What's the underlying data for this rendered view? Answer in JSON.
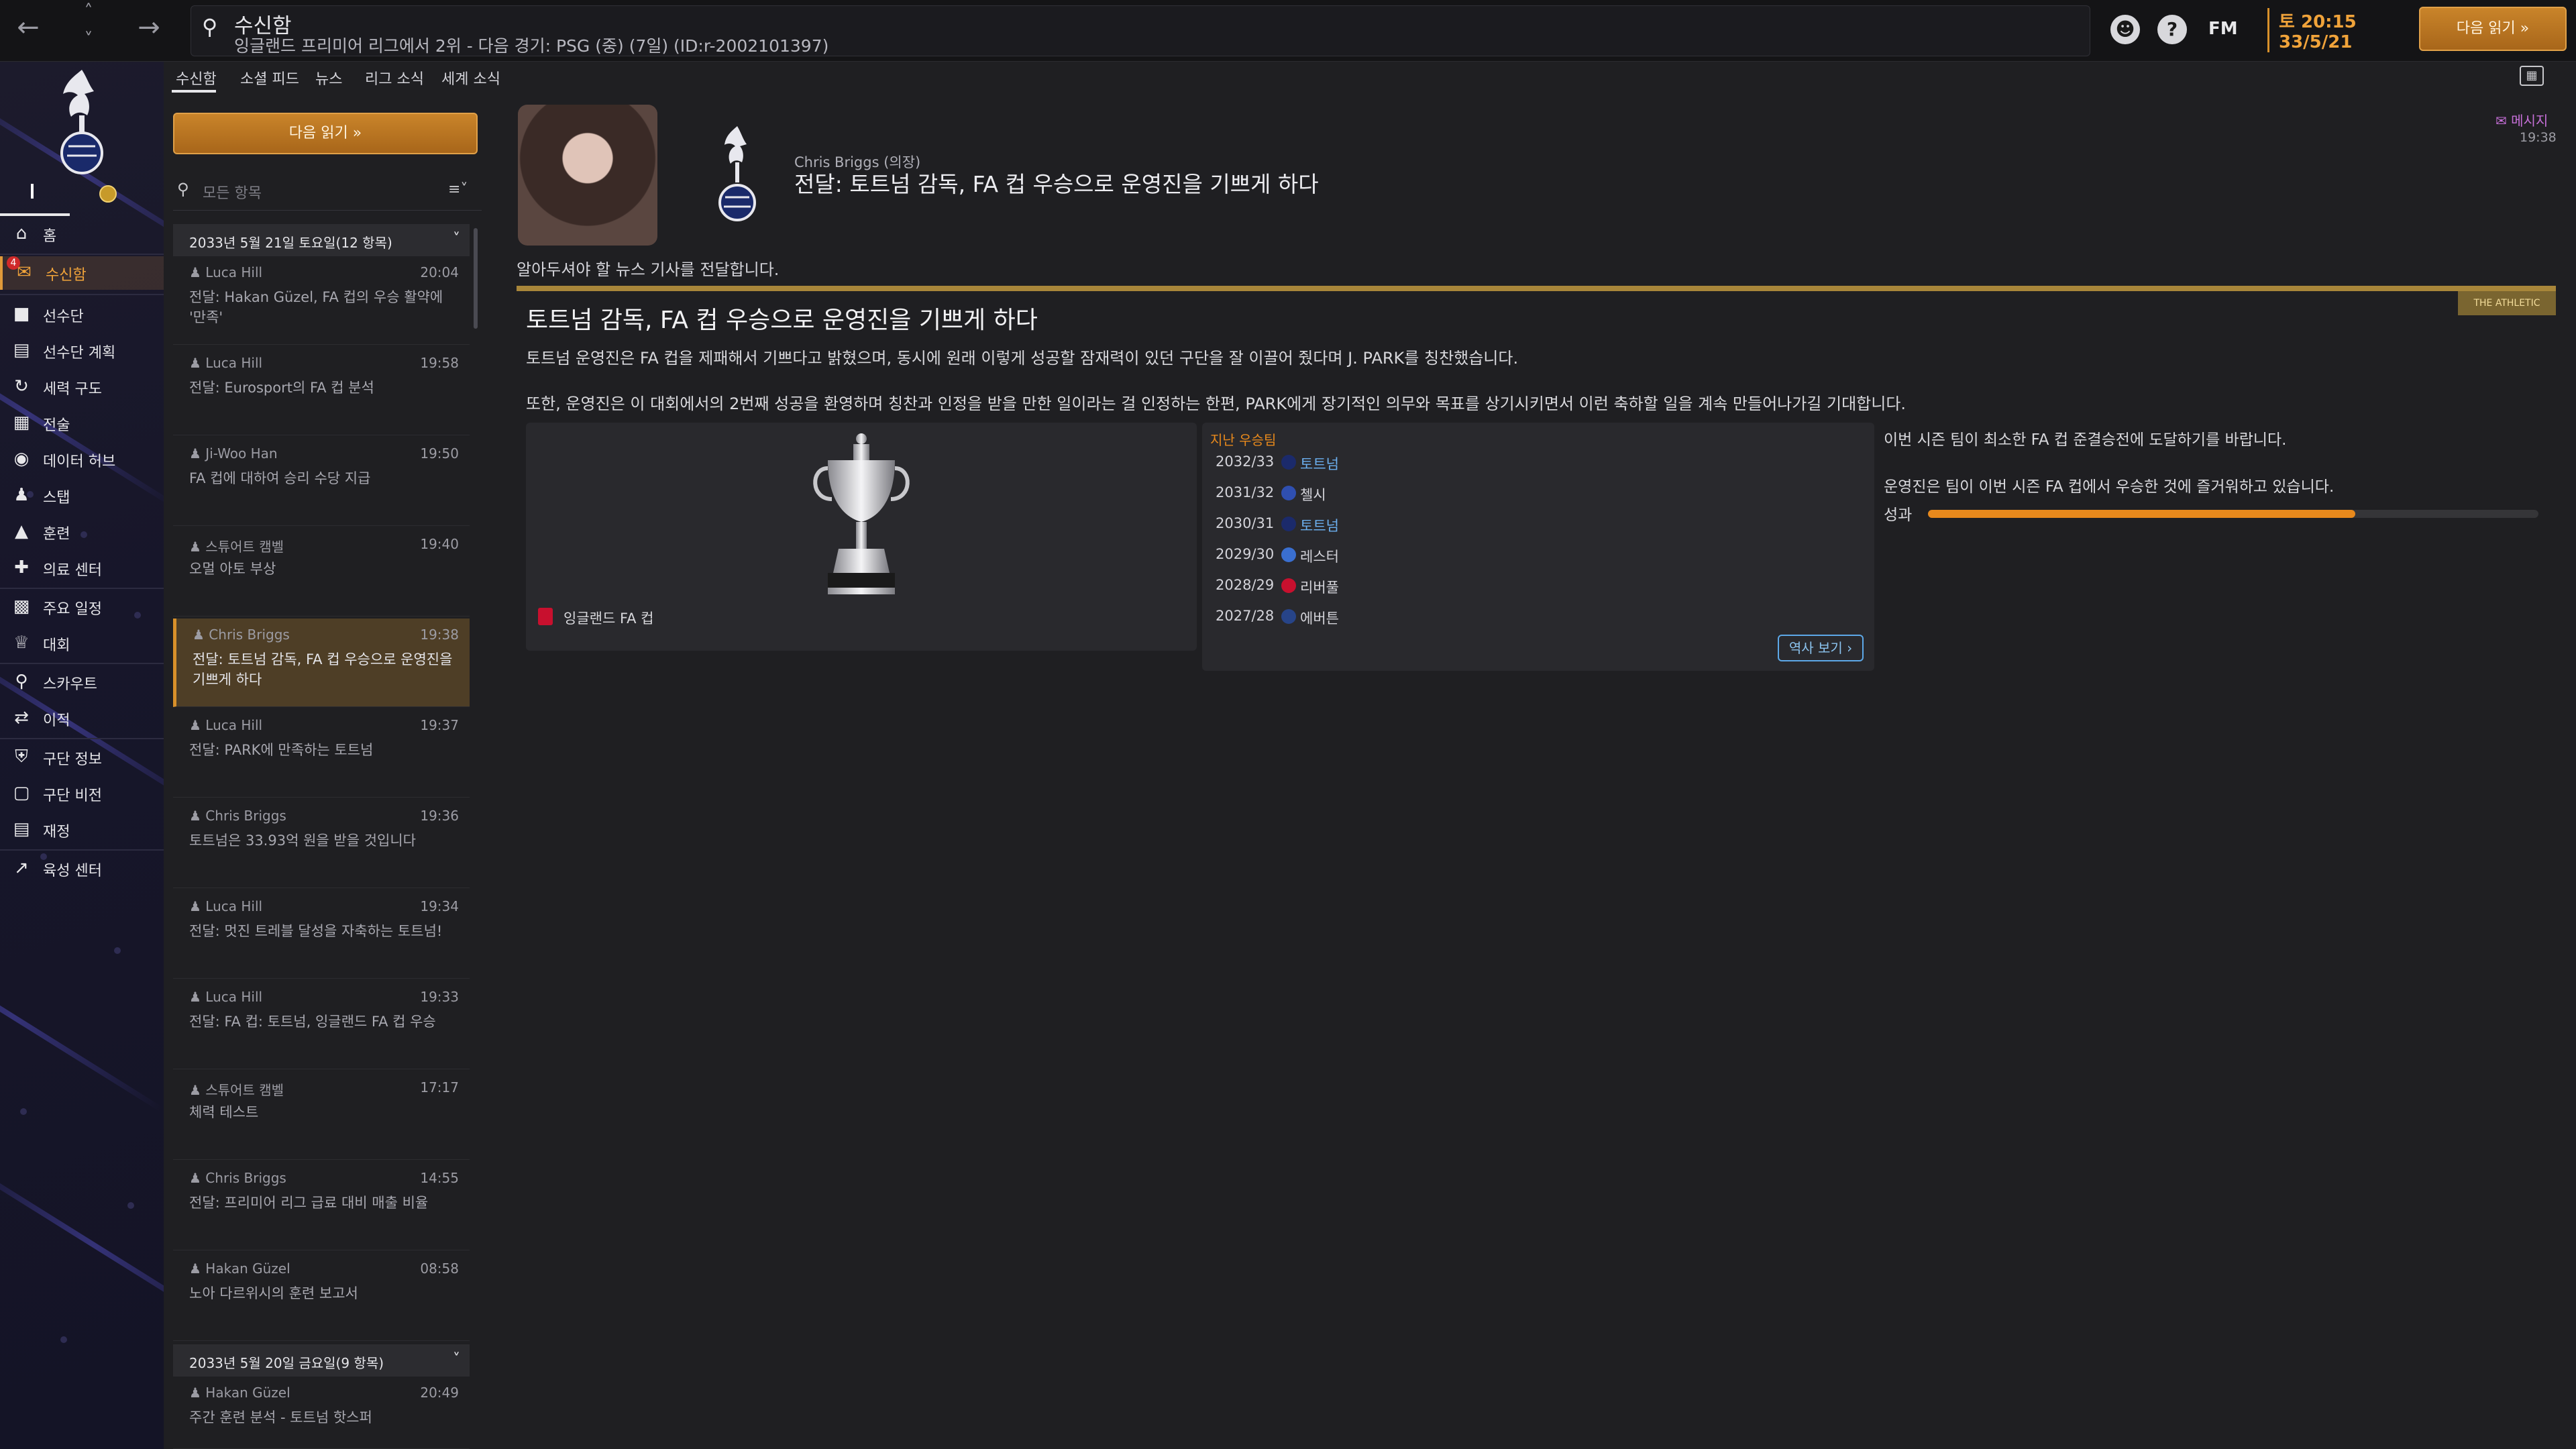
{
  "topbar": {
    "title": "수신함",
    "subtitle": "잉글랜드 프리미어 리그에서 2위 - 다음 경기: PSG (중) (7일) (ID:r-2002101397)",
    "fm_logo": "FM",
    "time": "토 20:15",
    "date": "33/5/21",
    "continue_label": "다음 읽기"
  },
  "sidebar": {
    "items": [
      {
        "label": "홈",
        "icon": "home-icon"
      },
      {
        "label": "수신함",
        "icon": "inbox-icon",
        "badge": "4"
      },
      {
        "label": "선수단",
        "icon": "shirt-icon"
      },
      {
        "label": "선수단 계획",
        "icon": "clipboard-icon"
      },
      {
        "label": "세력 구도",
        "icon": "dynamics-icon"
      },
      {
        "label": "전술",
        "icon": "tactics-icon"
      },
      {
        "label": "데이터 허브",
        "icon": "data-hub-icon"
      },
      {
        "label": "스탭",
        "icon": "staff-icon"
      },
      {
        "label": "훈련",
        "icon": "training-icon"
      },
      {
        "label": "의료 센터",
        "icon": "medical-icon"
      },
      {
        "label": "주요 일정",
        "icon": "calendar-icon"
      },
      {
        "label": "대회",
        "icon": "trophy-icon"
      },
      {
        "label": "스카우트",
        "icon": "scout-icon"
      },
      {
        "label": "이적",
        "icon": "transfer-icon"
      },
      {
        "label": "구단 정보",
        "icon": "club-info-icon"
      },
      {
        "label": "구단 비전",
        "icon": "vision-icon"
      },
      {
        "label": "재정",
        "icon": "finance-icon"
      },
      {
        "label": "육성 센터",
        "icon": "development-icon"
      }
    ]
  },
  "subtabs": [
    "수신함",
    "소셜 피드",
    "뉴스",
    "리그 소식",
    "세계 소식"
  ],
  "inbox": {
    "continue_label": "다음 읽기",
    "filter_placeholder": "모든 항목",
    "groups": [
      {
        "header": "2033년 5월 21일 토요일(12 항목)"
      },
      {
        "header": "2033년 5월 20일 금요일(9 항목)"
      }
    ],
    "messages": [
      {
        "from": "Luca Hill",
        "time": "20:04",
        "subject": "전달: Hakan Güzel, FA 컵의 우승 활약에 '만족'"
      },
      {
        "from": "Luca Hill",
        "time": "19:58",
        "subject": "전달: Eurosport의 FA 컵 분석"
      },
      {
        "from": "Ji-Woo Han",
        "time": "19:50",
        "subject": "FA 컵에 대하여 승리 수당 지급"
      },
      {
        "from": "스튜어트 캠벨",
        "time": "19:40",
        "subject": "오멀 아토 부상"
      },
      {
        "from": "Chris Briggs",
        "time": "19:38",
        "subject": "전달: 토트넘 감독, FA 컵 우승으로 운영진을 기쁘게 하다"
      },
      {
        "from": "Luca Hill",
        "time": "19:37",
        "subject": "전달: PARK에 만족하는 토트넘"
      },
      {
        "from": "Chris Briggs",
        "time": "19:36",
        "subject": "토트넘은 33.93억 원을 받을 것입니다"
      },
      {
        "from": "Luca Hill",
        "time": "19:34",
        "subject": "전달: 멋진 트레블 달성을 자축하는 토트넘!"
      },
      {
        "from": "Luca Hill",
        "time": "19:33",
        "subject": "전달: FA 컵: 토트넘, 잉글랜드 FA 컵 우승"
      },
      {
        "from": "스튜어트 캠벨",
        "time": "17:17",
        "subject": "체력 테스트"
      },
      {
        "from": "Chris Briggs",
        "time": "14:55",
        "subject": "전달: 프리미어 리그 급료 대비 매출 비율"
      },
      {
        "from": "Hakan Güzel",
        "time": "08:58",
        "subject": "노아 다르위시의 훈련 보고서"
      },
      {
        "from": "Hakan Güzel",
        "time": "20:49",
        "subject": "주간 훈련 분석 - 토트넘 핫스퍼"
      }
    ]
  },
  "message": {
    "from": "Chris Briggs (의장)",
    "headline": "전달: 토트넘 감독, FA 컵 우승으로 운영진을 기쁘게 하다",
    "badge": "메시지",
    "time": "19:38",
    "intro": "알아두셔야 할 뉴스 기사를 전달합니다.",
    "source": "THE ATHLETIC",
    "article_title": "토트넘 감독, FA 컵 우승으로 운영진을 기쁘게 하다",
    "p1": "토트넘 운영진은 FA 컵을 제패해서 기쁘다고 밝혔으며, 동시에 원래 이렇게 성공할 잠재력이 있던 구단을 잘 이끌어 줬다며 J. PARK를 칭찬했습니다.",
    "p2": "또한, 운영진은 이 대회에서의 2번째 성공을 환영하며 칭찬과 인정을 받을 만한 일이라는 걸 인정하는 한편, PARK에게 장기적인 의무와 목표를 상기시키면서 이런 축하할 일을 계속 만들어나가길 기대합니다.",
    "trophy_caption": "잉글랜드 FA 컵",
    "history_title": "지난 우승팀",
    "history": [
      {
        "season": "2032/33",
        "team": "토트넘",
        "color": "#1b2a6b",
        "link": true
      },
      {
        "season": "2031/32",
        "team": "첼시",
        "color": "#2f4fb0",
        "link": false
      },
      {
        "season": "2030/31",
        "team": "토트넘",
        "color": "#1b2a6b",
        "link": true
      },
      {
        "season": "2029/30",
        "team": "레스터",
        "color": "#3a6fd0",
        "link": false
      },
      {
        "season": "2028/29",
        "team": "리버풀",
        "color": "#c8102e",
        "link": false
      },
      {
        "season": "2027/28",
        "team": "에버튼",
        "color": "#274488",
        "link": false
      }
    ],
    "history_button": "역사 보기",
    "expectation_1": "이번 시즌 팀이 최소한 FA 컵 준결승전에 도달하기를 바랍니다.",
    "expectation_2": "운영진은 팀이 이번 시즌 FA 컵에서 우승한 것에 즐거워하고 있습니다.",
    "performance_label": "성과",
    "performance_value": 0.7
  },
  "colors": {
    "accent": "#e8891c",
    "link": "#6cb0f0",
    "message_badge": "#c66fd8"
  }
}
